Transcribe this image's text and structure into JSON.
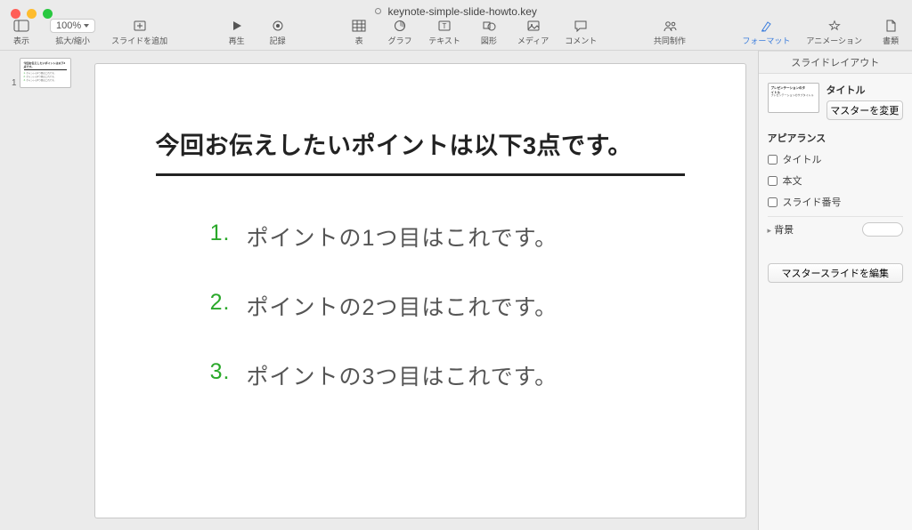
{
  "window": {
    "filename": "keynote-simple-slide-howto.key"
  },
  "toolbar": {
    "view_label": "表示",
    "zoom_value": "100%",
    "zoom_label": "拡大/縮小",
    "add_slide_label": "スライドを追加",
    "play_label": "再生",
    "record_label": "記録",
    "table_label": "表",
    "chart_label": "グラフ",
    "text_label": "テキスト",
    "shape_label": "図形",
    "media_label": "メディア",
    "comment_label": "コメント",
    "collab_label": "共同制作",
    "format_label": "フォーマット",
    "animate_label": "アニメーション",
    "document_label": "書類"
  },
  "thumbnails": {
    "items": [
      {
        "index": "1"
      }
    ]
  },
  "slide": {
    "title": "今回お伝えしたいポイントは以下3点です。",
    "items": [
      {
        "num": "1.",
        "text": "ポイントの1つ目はこれです。"
      },
      {
        "num": "2.",
        "text": "ポイントの2つ目はこれです。"
      },
      {
        "num": "3.",
        "text": "ポイントの3つ目はこれです。"
      }
    ]
  },
  "inspector": {
    "tab_format": "フォーマット",
    "tab_animate": "アニメーション",
    "tab_document": "書類",
    "section_title": "スライドレイアウト",
    "master_title_line1": "プレゼンテーションのタ",
    "master_title_line2": "イトル",
    "master_sub": "プレゼンテーションのサブタイトル",
    "label_title": "タイトル",
    "btn_change_master": "マスターを変更",
    "appearance": "アピアランス",
    "chk_title": "タイトル",
    "chk_body": "本文",
    "chk_slidenum": "スライド番号",
    "bg_label": "背景",
    "btn_edit_master": "マスタースライドを編集"
  }
}
